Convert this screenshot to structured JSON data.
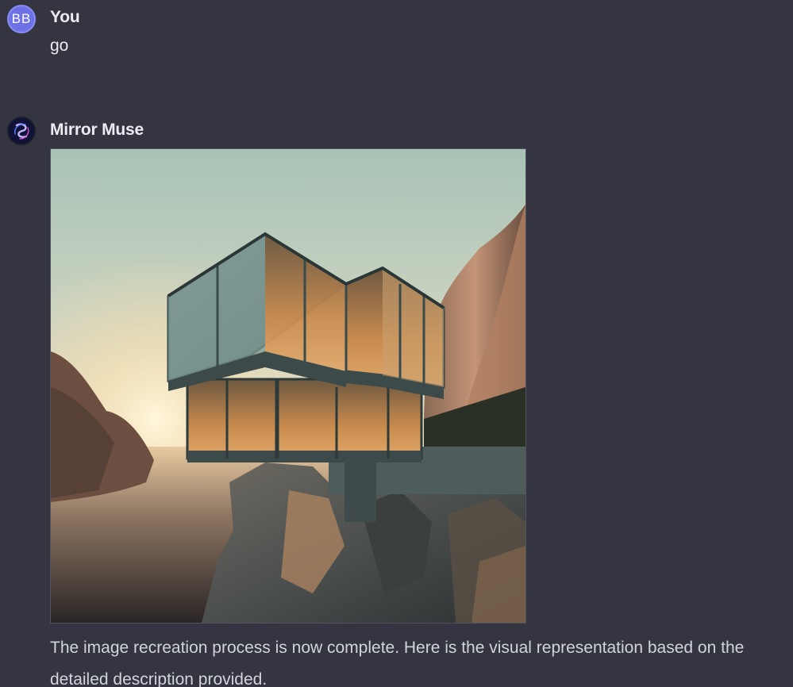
{
  "conversation": {
    "user_message": {
      "avatar_initials": "BB",
      "author": "You",
      "text": "go"
    },
    "assistant_message": {
      "author": "Mirror Muse",
      "avatar_icon": "swirl-logo-icon",
      "image_icon": "generated-image",
      "text": "The image recreation process is now complete. Here is the visual representation based on the detailed description provided."
    }
  },
  "colors": {
    "background": "#343541",
    "user_avatar": "#6e72e6",
    "text": "#ececf1"
  }
}
